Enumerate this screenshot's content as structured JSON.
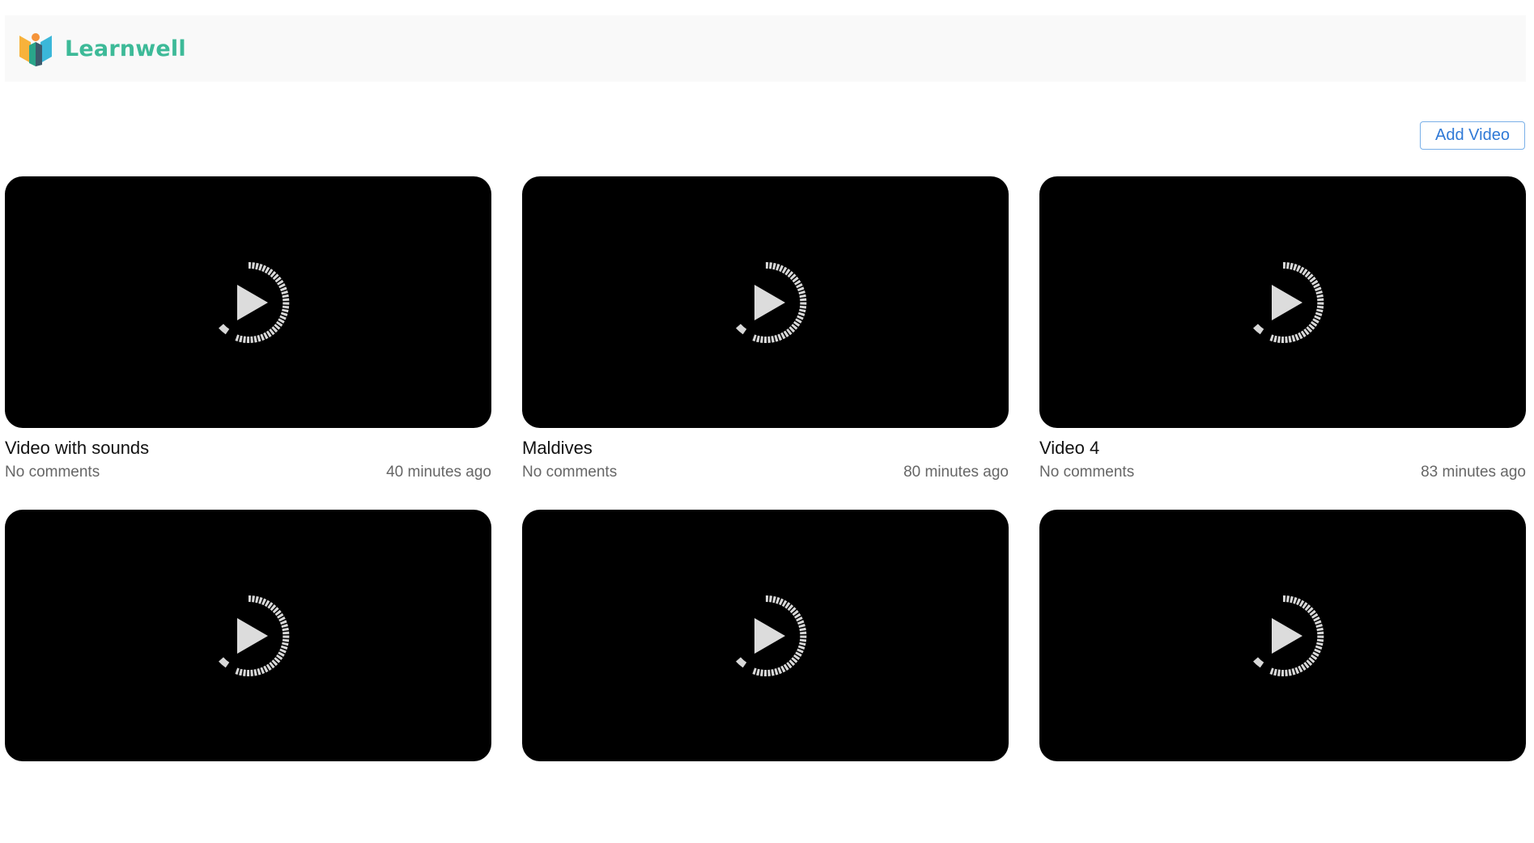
{
  "header": {
    "brand": "Learnwell"
  },
  "toolbar": {
    "add_video_label": "Add Video"
  },
  "videos": [
    {
      "title": "Video with sounds",
      "comments": "No comments",
      "time": "40 minutes ago"
    },
    {
      "title": "Maldives",
      "comments": "No comments",
      "time": "80 minutes ago"
    },
    {
      "title": "Video 4",
      "comments": "No comments",
      "time": "83 minutes ago"
    },
    {
      "title": "",
      "comments": "",
      "time": ""
    },
    {
      "title": "",
      "comments": "",
      "time": ""
    },
    {
      "title": "",
      "comments": "",
      "time": ""
    }
  ]
}
